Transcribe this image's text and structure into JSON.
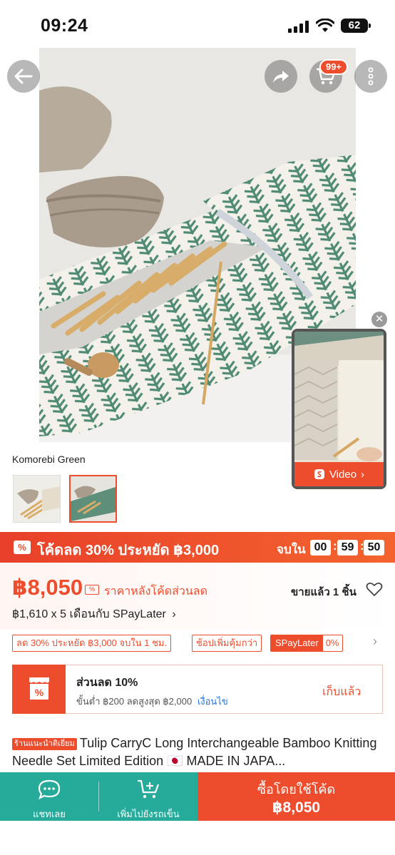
{
  "status_bar": {
    "time": "09:24",
    "battery": "62"
  },
  "header": {
    "cart_badge": "99+"
  },
  "gallery": {
    "variant_name": "Komorebi Green",
    "video_label": "Video",
    "video_arrow": "›"
  },
  "voucher_bar": {
    "icon": "%",
    "text": "โค้ดลด 30% ประหยัด ฿3,000",
    "ends_label": "จบใน",
    "hh": "00",
    "mm": "59",
    "ss": "50",
    "colon": ":"
  },
  "price": {
    "value": "฿8,050",
    "note": "ราคาหลังโค้ดส่วนลด",
    "sold": "ขายแล้ว 1 ชิ้น",
    "installment": "฿1,610 x 5 เดือนกับ SPayLater",
    "installment_arrow": "›"
  },
  "chips": {
    "discount": "ลด 30% ประหยัด ฿3,000 จบใน 1 ชม.",
    "more_worth": "ช้อปเพิ่มคุ้มกว่า",
    "spaylater": "SPayLater",
    "spaylater_rate": "0%",
    "arrow": "›"
  },
  "shop_voucher": {
    "title": "ส่วนลด 10%",
    "subtitle": "ขั้นต่ำ ฿200 ลดสูงสุด ฿2,000",
    "conditions_link": "เงื่อนไข",
    "status": "เก็บแล้ว"
  },
  "product": {
    "badge": "ร้านแนะนำติเยี่ยม",
    "title": "Tulip CarryC Long Interchangeable Bamboo Knitting Needle Set Limited Edition 🇯🇵 MADE IN JAPA..."
  },
  "bottom_bar": {
    "chat_label": "แชทเลย",
    "add_to_cart_label": "เพิ่มไปยังรถเข็น",
    "buy_label": "ซื้อโดยใช้โค้ด",
    "buy_price": "฿8,050"
  },
  "colors": {
    "brand_orange": "#ee4d2d",
    "green": "#26aa99",
    "link_blue": "#2673dd"
  }
}
